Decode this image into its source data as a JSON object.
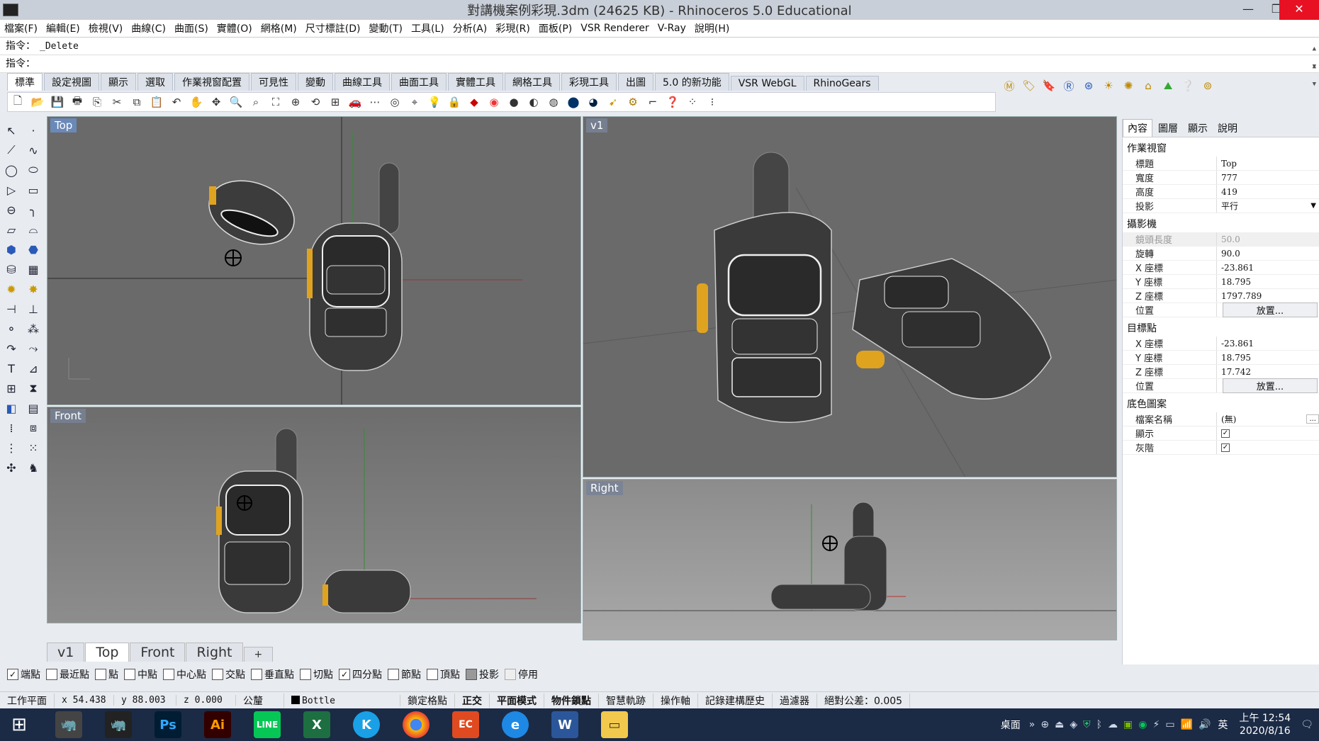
{
  "window": {
    "title": "對講機案例彩現.3dm (24625 KB) - Rhinoceros 5.0 Educational",
    "min": "—",
    "max": "❐",
    "close": "✕"
  },
  "menu": [
    "檔案(F)",
    "編輯(E)",
    "檢視(V)",
    "曲線(C)",
    "曲面(S)",
    "實體(O)",
    "網格(M)",
    "尺寸標註(D)",
    "變動(T)",
    "工具(L)",
    "分析(A)",
    "彩現(R)",
    "面板(P)",
    "VSR Renderer",
    "V-Ray",
    "說明(H)"
  ],
  "command": {
    "history_label": "指令：",
    "history_value": "_Delete",
    "prompt_label": "指令：",
    "prompt_value": ""
  },
  "toolbar_tabs": [
    "標準",
    "設定視圖",
    "顯示",
    "選取",
    "作業視窗配置",
    "可見性",
    "變動",
    "曲線工具",
    "曲面工具",
    "實體工具",
    "網格工具",
    "彩現工具",
    "出圖",
    "5.0 的新功能",
    "VSR WebGL",
    "RhinoGears"
  ],
  "viewports": {
    "top": {
      "label": "Top"
    },
    "front": {
      "label": "Front"
    },
    "v1": {
      "label": "v1"
    },
    "right": {
      "label": "Right"
    }
  },
  "viewport_tabs": [
    "v1",
    "Top",
    "Front",
    "Right",
    "+"
  ],
  "panel": {
    "tabs": [
      "內容",
      "圖層",
      "顯示",
      "說明"
    ],
    "viewport_section": "作業視窗",
    "title_k": "標題",
    "title_v": "Top",
    "width_k": "寬度",
    "width_v": "777",
    "height_k": "高度",
    "height_v": "419",
    "proj_k": "投影",
    "proj_v": "平行",
    "camera_section": "攝影機",
    "lens_k": "鏡頭長度",
    "lens_v": "50.0",
    "rot_k": "旋轉",
    "rot_v": "90.0",
    "cx_k": "X 座標",
    "cx_v": "-23.861",
    "cy_k": "Y 座標",
    "cy_v": "18.795",
    "cz_k": "Z 座標",
    "cz_v": "1797.789",
    "cpos_k": "位置",
    "cpos_v": "放置...",
    "target_section": "目標點",
    "tx_k": "X 座標",
    "tx_v": "-23.861",
    "ty_k": "Y 座標",
    "ty_v": "18.795",
    "tz_k": "Z 座標",
    "tz_v": "17.742",
    "tpos_k": "位置",
    "tpos_v": "放置...",
    "bg_section": "底色圖案",
    "file_k": "檔案名稱",
    "file_v": "(無)",
    "show_k": "顯示",
    "gray_k": "灰階"
  },
  "osnaps": [
    {
      "label": "端點",
      "checked": true
    },
    {
      "label": "最近點",
      "checked": false
    },
    {
      "label": "點",
      "checked": false
    },
    {
      "label": "中點",
      "checked": false
    },
    {
      "label": "中心點",
      "checked": false
    },
    {
      "label": "交點",
      "checked": false
    },
    {
      "label": "垂直點",
      "checked": false
    },
    {
      "label": "切點",
      "checked": false
    },
    {
      "label": "四分點",
      "checked": true
    },
    {
      "label": "節點",
      "checked": false
    },
    {
      "label": "頂點",
      "checked": false
    },
    {
      "label": "投影",
      "checked": false
    },
    {
      "label": "停用",
      "checked": false
    }
  ],
  "status": {
    "cplane": "工作平面",
    "x": "x 54.438",
    "y": "y 88.003",
    "z": "z 0.000",
    "units": "公釐",
    "layer": "Bottle",
    "grid": "鎖定格點",
    "ortho": "正交",
    "planar": "平面模式",
    "osnap": "物件鎖點",
    "smarttrack": "智慧軌跡",
    "gumball": "操作軸",
    "history": "記錄建構歷史",
    "filter": "過濾器",
    "tolerance": "絕對公差：0.005"
  },
  "taskbar": {
    "desktop_label": "桌面",
    "ime": "英",
    "time": "上午 12:54",
    "date": "2020/8/16",
    "apps": [
      "win",
      "rhino",
      "rhino6",
      "Ps",
      "Ai",
      "LINE",
      "excel",
      "k",
      "chrome",
      "ec",
      "ie",
      "word",
      "explorer"
    ]
  }
}
